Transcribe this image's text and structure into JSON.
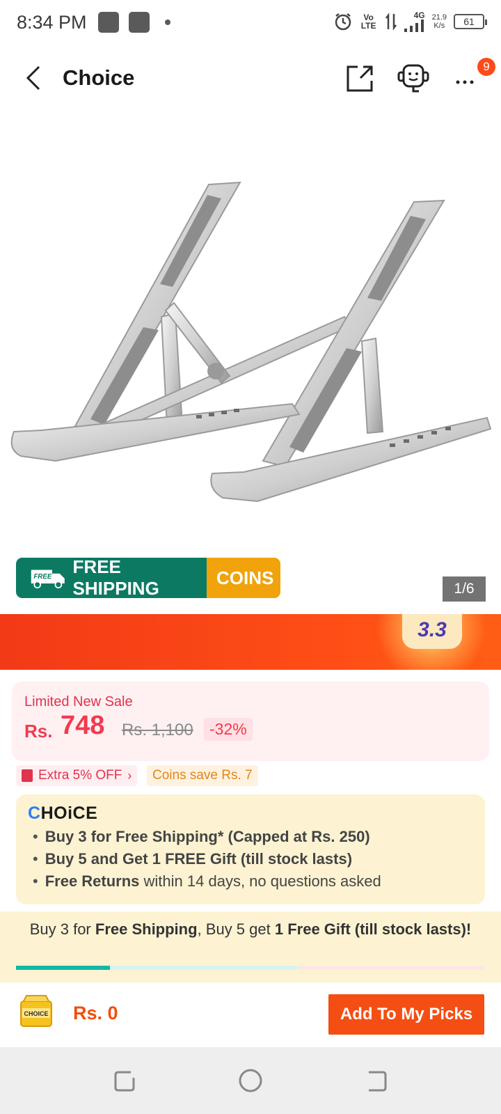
{
  "status_bar": {
    "time": "8:34 PM",
    "volte": "Vo LTE",
    "network": "4G",
    "speed_value": "21.9",
    "speed_unit": "K/s",
    "battery": "61"
  },
  "header": {
    "title": "Choice",
    "notification_count": "9"
  },
  "gallery": {
    "product_image": "aluminium laptop stand (two folding legs)",
    "pager": "1/6"
  },
  "promo": {
    "truck_label": "FREE",
    "free_shipping": "FREE SHIPPING",
    "coins": "COINS"
  },
  "event_badge": "3.3",
  "price": {
    "label": "Limited New Sale",
    "currency": "Rs.",
    "value": "748",
    "original": "Rs. 1,100",
    "discount": "-32%"
  },
  "tags": {
    "extra": "Extra 5% OFF",
    "coins_save": "Coins save Rs. 7"
  },
  "choice": {
    "logo_a": "C",
    "logo_b": "HOiCE",
    "benefits": [
      {
        "bold": "Buy 3 for  Free Shipping* (Capped at Rs. 250)",
        "rest": ""
      },
      {
        "bold": "Buy 5 and Get 1 FREE Gift (till stock lasts)",
        "rest": ""
      },
      {
        "bold": "Free Returns",
        "rest": " within 14 days, no questions asked"
      }
    ]
  },
  "bundle": {
    "p1": "Buy 3 for ",
    "b1": "Free Shipping",
    "p2": ", Buy 5 get ",
    "b2": "1 Free Gift (till stock lasts)!",
    "progress": 0.2
  },
  "bottom": {
    "cart_label": "CHOICE",
    "total": "Rs. 0",
    "add_button": "Add To My Picks"
  },
  "colors": {
    "accent_orange": "#f44e14",
    "free_shipping_green": "#0c7a63",
    "coins_yellow": "#f0a30a",
    "price_red": "#f23a4d",
    "progress_teal": "#13b7a5"
  }
}
